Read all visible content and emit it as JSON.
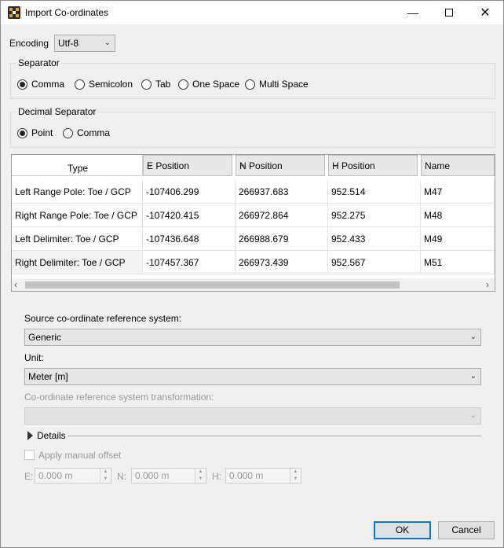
{
  "window": {
    "title": "Import Co-ordinates"
  },
  "encoding": {
    "label": "Encoding",
    "value": "Utf-8"
  },
  "separator": {
    "label": "Separator",
    "options": [
      "Comma",
      "Semicolon",
      "Tab",
      "One Space",
      "Multi Space"
    ],
    "selected": "Comma"
  },
  "decimal_separator": {
    "label": "Decimal Separator",
    "options": [
      "Point",
      "Comma"
    ],
    "selected": "Point"
  },
  "table": {
    "columns": [
      "Type",
      "E Position",
      "N Position",
      "H Position",
      "Name"
    ],
    "rows": [
      [
        "Left Range Pole: Toe / GCP",
        "-107406.299",
        "266937.683",
        "952.514",
        "M47"
      ],
      [
        "Right Range Pole: Toe / GCP",
        "-107420.415",
        "266972.864",
        "952.275",
        "M48"
      ],
      [
        "Left Delimiter: Toe / GCP",
        "-107436.648",
        "266988.679",
        "952.433",
        "M49"
      ],
      [
        "Right Delimiter: Toe / GCP",
        "-107457.367",
        "266973.439",
        "952.567",
        "M51"
      ]
    ]
  },
  "source_crs": {
    "label": "Source co-ordinate reference system:",
    "value": "Generic"
  },
  "unit": {
    "label": "Unit:",
    "value": "Meter [m]"
  },
  "transformation": {
    "label": "Co-ordinate reference system transformation:",
    "value": ""
  },
  "details": {
    "label": "Details"
  },
  "manual_offset": {
    "label": "Apply manual offset",
    "e_label": "E:",
    "e_value": "0.000 m",
    "n_label": "N:",
    "n_value": "0.000 m",
    "h_label": "H:",
    "h_value": "0.000 m"
  },
  "buttons": {
    "ok": "OK",
    "cancel": "Cancel"
  },
  "icons": [
    "app-icon",
    "minimize-icon",
    "maximize-icon",
    "close-icon",
    "chevron-down-icon",
    "scroll-left-icon",
    "scroll-right-icon",
    "expand-arrow-icon",
    "spin-up-icon",
    "spin-down-icon"
  ],
  "colors": {
    "accent": "#0078d7",
    "background": "#f0f0f0"
  }
}
